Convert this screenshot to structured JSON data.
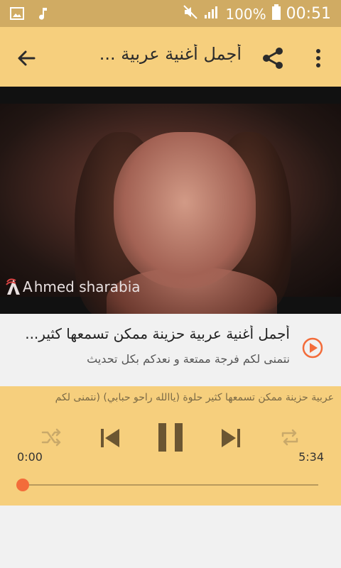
{
  "status_bar": {
    "battery": "100%",
    "time": "00:51"
  },
  "app_bar": {
    "title": "أجمل أغنية عربية ..."
  },
  "video": {
    "watermark": "hmed sharabia",
    "watermark_initial": "A"
  },
  "info": {
    "title": "أجمل أغنية عربية حزينة ممكن تسمعها كثير...",
    "subtitle": "نتمنى لكم فرجة ممتعة و نعدكم بكل تحديث"
  },
  "player": {
    "marquee": "عربية حزينة ممكن تسمعها كثير حلوة (ياالله راحو حبابي) (نتمنى لكم",
    "elapsed": "0:00",
    "duration": "5:34",
    "progress": 0.0
  },
  "colors": {
    "status_bg": "#d0ab63",
    "appbar_bg": "#f6cf7d",
    "accent": "#f36c3a",
    "player_icon": "#6b5632",
    "player_icon_disabled": "#c9a96a"
  }
}
